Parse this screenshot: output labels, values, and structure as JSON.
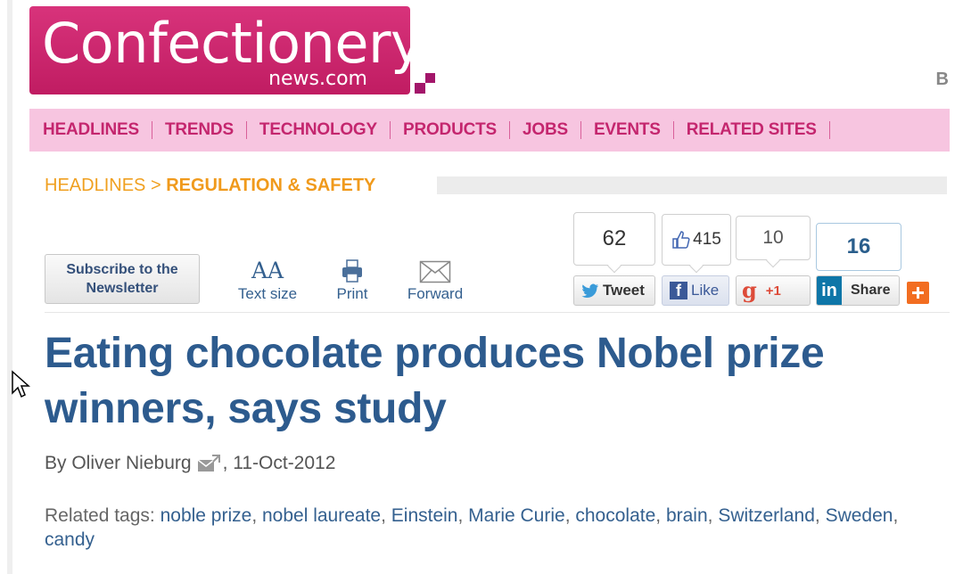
{
  "site": {
    "logo_main": "Confectionery",
    "logo_sub": "news.com",
    "top_right_letter": "B"
  },
  "nav": {
    "items": [
      "HEADLINES",
      "TRENDS",
      "TECHNOLOGY",
      "PRODUCTS",
      "JOBS",
      "EVENTS",
      "RELATED SITES"
    ]
  },
  "breadcrumb": {
    "parent": "HEADLINES",
    "separator": ">",
    "current": "REGULATION & SAFETY"
  },
  "toolbar": {
    "subscribe_line1": "Subscribe to the",
    "subscribe_line2": "Newsletter",
    "text_size_icon_text": "AA",
    "text_size_label": "Text size",
    "print_label": "Print",
    "forward_label": "Forward"
  },
  "social": {
    "tweet_count": "62",
    "tweet_label": "Tweet",
    "like_count": "415",
    "like_label": "Like",
    "gplus_count": "10",
    "gplus_label": "+1",
    "gplus_icon_text": "g",
    "linkedin_count": "16",
    "linkedin_label": "Share",
    "linkedin_icon_text": "in"
  },
  "article": {
    "title": "Eating chocolate produces Nobel prize winners, says study",
    "byline_prefix": "By Oliver Nieburg",
    "date": ", 11-Oct-2012",
    "tags_label": "Related tags:",
    "tags": [
      "noble prize",
      "nobel laureate",
      "Einstein",
      "Marie Curie",
      "chocolate",
      "brain",
      "Switzerland",
      "Sweden",
      "candy"
    ]
  },
  "colors": {
    "brand": "#cc1f6a",
    "nav_bg": "#f7c5e0",
    "nav_text": "#c4266e",
    "breadcrumb": "#f0a020",
    "headline": "#2d5b8e",
    "link": "#34608f"
  }
}
